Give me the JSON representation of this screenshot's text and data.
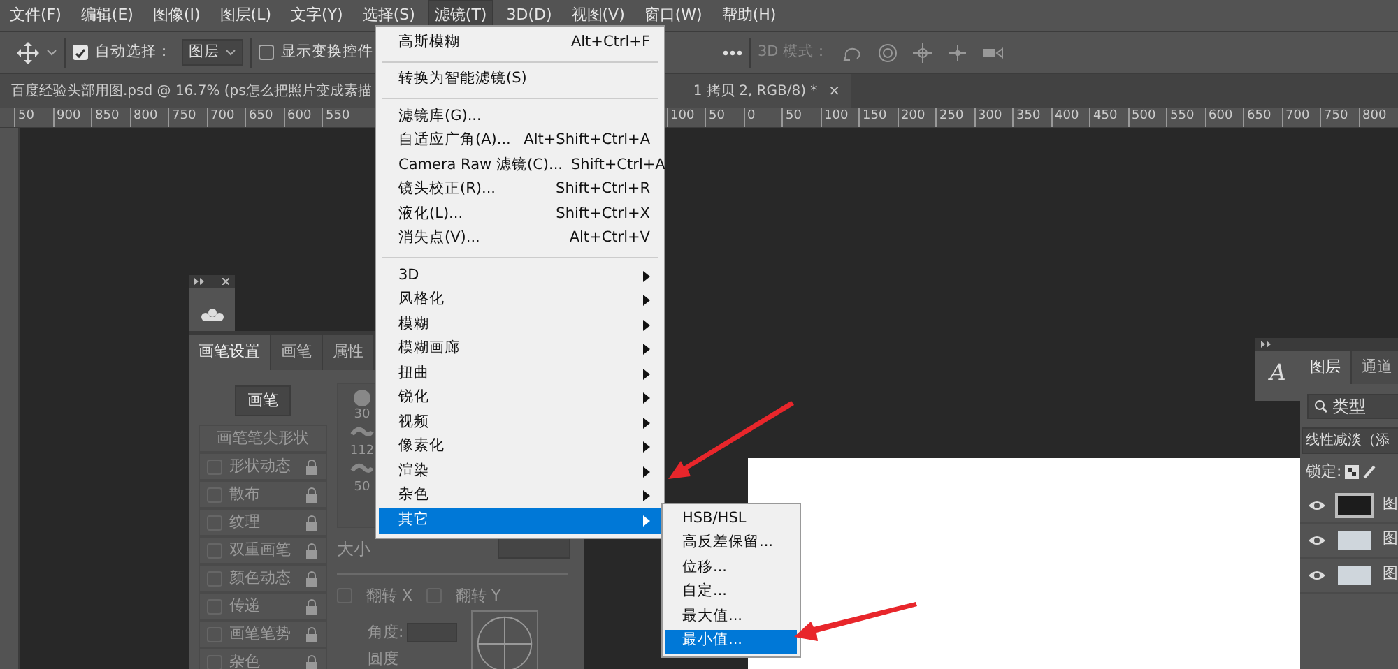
{
  "menubar": [
    {
      "label": "文件(F)",
      "selected": false
    },
    {
      "label": "编辑(E)",
      "selected": false
    },
    {
      "label": "图像(I)",
      "selected": false
    },
    {
      "label": "图层(L)",
      "selected": false
    },
    {
      "label": "文字(Y)",
      "selected": false
    },
    {
      "label": "选择(S)",
      "selected": false
    },
    {
      "label": "滤镜(T)",
      "selected": true
    },
    {
      "label": "3D(D)",
      "selected": false
    },
    {
      "label": "视图(V)",
      "selected": false
    },
    {
      "label": "窗口(W)",
      "selected": false
    },
    {
      "label": "帮助(H)",
      "selected": false
    }
  ],
  "options_bar": {
    "auto_select": {
      "label": "自动选择：",
      "checked": true
    },
    "auto_select_target": "图层",
    "transform_controls": {
      "label": "显示变换控件",
      "checked": false
    },
    "mode_label": "3D 模式："
  },
  "document_tab": {
    "title_start": "百度经验头部用图.psd @ 16.7% (ps怎么把照片变成素描",
    "title_end": "1 拷贝 2, RGB/8) *",
    "close": "×"
  },
  "ruler": {
    "left_ticks": [
      "50",
      "900",
      "850",
      "800",
      "750",
      "700",
      "650",
      "600",
      "550"
    ],
    "right_ticks": [
      "100",
      "50",
      "0",
      "50",
      "100",
      "150",
      "200",
      "250",
      "300",
      "350",
      "400",
      "450",
      "500",
      "550",
      "600",
      "650",
      "700",
      "750",
      "800"
    ]
  },
  "brush_panel": {
    "tabs": [
      {
        "label": "画笔设置",
        "selected": true
      },
      {
        "label": "画笔",
        "selected": false
      },
      {
        "label": "属性",
        "selected": false
      }
    ],
    "brush_button": "画笔",
    "options": [
      {
        "kind": "header",
        "label": "画笔笔尖形状"
      },
      {
        "kind": "option",
        "label": "形状动态",
        "checked": false
      },
      {
        "kind": "option",
        "label": "散布",
        "checked": false
      },
      {
        "kind": "option",
        "label": "纹理",
        "checked": false
      },
      {
        "kind": "option",
        "label": "双重画笔",
        "checked": false
      },
      {
        "kind": "option",
        "label": "颜色动态",
        "checked": false
      },
      {
        "kind": "option",
        "label": "传递",
        "checked": false
      },
      {
        "kind": "option",
        "label": "画笔笔势",
        "checked": false
      },
      {
        "kind": "option",
        "label": "杂色",
        "checked": false
      }
    ],
    "presets": [
      "30",
      "112",
      "50"
    ],
    "size_label": "大小",
    "flip": [
      {
        "label": "翻转 X",
        "checked": false
      },
      {
        "label": "翻转 Y",
        "checked": false
      }
    ],
    "angle_label": "角度:",
    "roundness_label": "圆度"
  },
  "layers_panel": {
    "character_icon": "A",
    "tabs": [
      {
        "label": "图层",
        "selected": true
      },
      {
        "label": "通道",
        "selected": false
      }
    ],
    "filter": "类型",
    "blend_mode": "线性减淡（添",
    "lock_label": "锁定:",
    "layers": [
      {
        "name": "图",
        "visible": true,
        "selected": true
      },
      {
        "name": "图",
        "visible": true,
        "selected": false
      },
      {
        "name": "图",
        "visible": true,
        "selected": false
      }
    ]
  },
  "filter_menu": {
    "items": [
      {
        "kind": "item",
        "label": "高斯模糊",
        "shortcut": "Alt+Ctrl+F",
        "selected": false
      },
      {
        "kind": "separator"
      },
      {
        "kind": "item",
        "label": "转换为智能滤镜(S)",
        "selected": false
      },
      {
        "kind": "separator"
      },
      {
        "kind": "item",
        "label": "滤镜库(G)...",
        "selected": false
      },
      {
        "kind": "item",
        "label": "自适应广角(A)...",
        "shortcut": "Alt+Shift+Ctrl+A",
        "selected": false
      },
      {
        "kind": "item",
        "label": "Camera Raw 滤镜(C)...",
        "shortcut": "Shift+Ctrl+A",
        "selected": false
      },
      {
        "kind": "item",
        "label": "镜头校正(R)...",
        "shortcut": "Shift+Ctrl+R",
        "selected": false
      },
      {
        "kind": "item",
        "label": "液化(L)...",
        "shortcut": "Shift+Ctrl+X",
        "selected": false
      },
      {
        "kind": "item",
        "label": "消失点(V)...",
        "shortcut": "Alt+Ctrl+V",
        "selected": false
      },
      {
        "kind": "separator"
      },
      {
        "kind": "submenu",
        "label": "3D",
        "selected": false
      },
      {
        "kind": "submenu",
        "label": "风格化",
        "selected": false
      },
      {
        "kind": "submenu",
        "label": "模糊",
        "selected": false
      },
      {
        "kind": "submenu",
        "label": "模糊画廊",
        "selected": false
      },
      {
        "kind": "submenu",
        "label": "扭曲",
        "selected": false
      },
      {
        "kind": "submenu",
        "label": "锐化",
        "selected": false
      },
      {
        "kind": "submenu",
        "label": "视频",
        "selected": false
      },
      {
        "kind": "submenu",
        "label": "像素化",
        "selected": false
      },
      {
        "kind": "submenu",
        "label": "渲染",
        "selected": false
      },
      {
        "kind": "submenu",
        "label": "杂色",
        "selected": false
      },
      {
        "kind": "submenu",
        "label": "其它",
        "selected": true
      }
    ]
  },
  "submenu": {
    "items": [
      {
        "label": "HSB/HSL",
        "selected": false
      },
      {
        "label": "高反差保留...",
        "selected": false
      },
      {
        "label": "位移...",
        "selected": false
      },
      {
        "label": "自定...",
        "selected": false
      },
      {
        "label": "最大值...",
        "selected": false
      },
      {
        "label": "最小值...",
        "selected": true
      }
    ]
  }
}
